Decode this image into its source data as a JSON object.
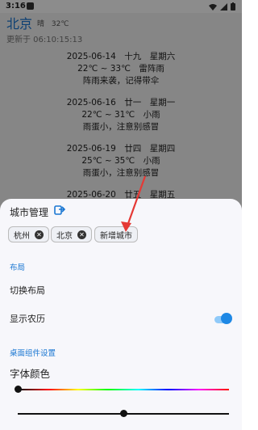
{
  "status_bar": {
    "time": "3:16"
  },
  "weather": {
    "city": "北京",
    "condition": "晴",
    "temperature": "32℃",
    "updated": "更新于 06:10:15:13",
    "days": [
      {
        "date_line": "2025-06-14　十九　星期六",
        "temp_line": "22℃ ~ 33℃　雷阵雨",
        "tip": "阵雨来袭，记得带伞"
      },
      {
        "date_line": "2025-06-16　廿一　星期一",
        "temp_line": "22℃ ~ 31℃　小雨",
        "tip": "雨蛋小，注意别感冒"
      },
      {
        "date_line": "2025-06-19　廿四　星期四",
        "temp_line": "25℃ ~ 35℃　小雨",
        "tip": "雨蛋小，注意别感冒"
      },
      {
        "date_line": "2025-06-20　廿五　星期五",
        "temp_line": "",
        "tip": ""
      }
    ]
  },
  "sheet": {
    "title": "城市管理",
    "cities": [
      {
        "name": "杭州"
      },
      {
        "name": "北京"
      }
    ],
    "add_city_label": "新增城市",
    "layout_section": "布局",
    "switch_layout": "切换布局",
    "show_lunar": "显示农历",
    "show_lunar_on": true,
    "widget_section": "桌面组件设置",
    "font_color_label": "字体颜色",
    "color_slider_value": 0,
    "second_slider_value": 0.5
  },
  "colors": {
    "accent": "#1976d2",
    "toggle": "#1e88e5"
  }
}
